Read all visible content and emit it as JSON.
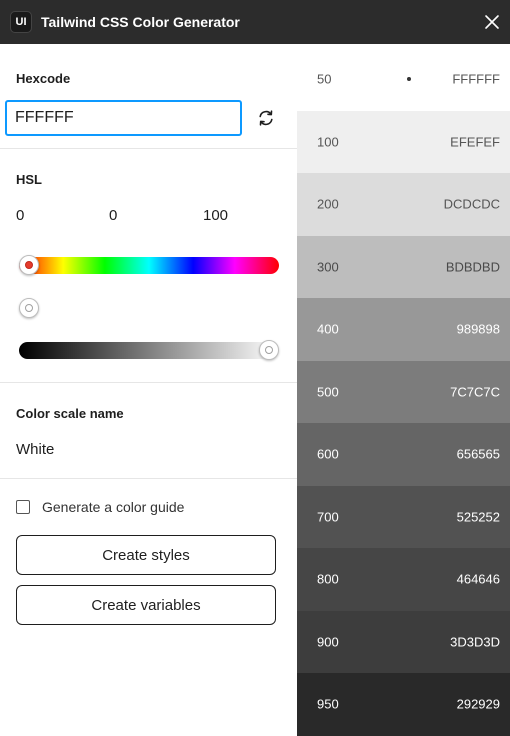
{
  "window": {
    "app_icon_text": "UI",
    "title": "Tailwind CSS Color Generator"
  },
  "hexcode": {
    "label": "Hexcode",
    "value": "FFFFFF"
  },
  "hsl": {
    "label": "HSL",
    "h": "0",
    "s": "0",
    "l": "100",
    "hue_fraction": 0,
    "saturation_fraction": 0,
    "lightness_fraction": 1
  },
  "color_scale": {
    "label": "Color scale name",
    "name": "White"
  },
  "guide": {
    "checkbox_label": "Generate a color guide",
    "checked": false
  },
  "buttons": {
    "create_styles": "Create styles",
    "create_variables": "Create variables"
  },
  "swatches": [
    {
      "shade": "50",
      "hex": "FFFFFF",
      "color": "#FFFFFF",
      "text_color": "#555555",
      "selected": true
    },
    {
      "shade": "100",
      "hex": "EFEFEF",
      "color": "#EFEFEF",
      "text_color": "#555555",
      "selected": false
    },
    {
      "shade": "200",
      "hex": "DCDCDC",
      "color": "#DCDCDC",
      "text_color": "#555555",
      "selected": false
    },
    {
      "shade": "300",
      "hex": "BDBDBD",
      "color": "#BDBDBD",
      "text_color": "#4a4a4a",
      "selected": false
    },
    {
      "shade": "400",
      "hex": "989898",
      "color": "#989898",
      "text_color": "#ffffff",
      "selected": false
    },
    {
      "shade": "500",
      "hex": "7C7C7C",
      "color": "#7C7C7C",
      "text_color": "#ffffff",
      "selected": false
    },
    {
      "shade": "600",
      "hex": "656565",
      "color": "#656565",
      "text_color": "#ffffff",
      "selected": false
    },
    {
      "shade": "700",
      "hex": "525252",
      "color": "#525252",
      "text_color": "#ffffff",
      "selected": false
    },
    {
      "shade": "800",
      "hex": "464646",
      "color": "#464646",
      "text_color": "#ffffff",
      "selected": false
    },
    {
      "shade": "900",
      "hex": "3D3D3D",
      "color": "#3D3D3D",
      "text_color": "#ffffff",
      "selected": false
    },
    {
      "shade": "950",
      "hex": "292929",
      "color": "#292929",
      "text_color": "#ffffff",
      "selected": false
    }
  ],
  "icons": {
    "app": "app-icon",
    "close": "close-icon",
    "refresh": "refresh-icon"
  },
  "colors": {
    "titlebar": "#2c2c2c",
    "focus": "#0d99ff"
  }
}
